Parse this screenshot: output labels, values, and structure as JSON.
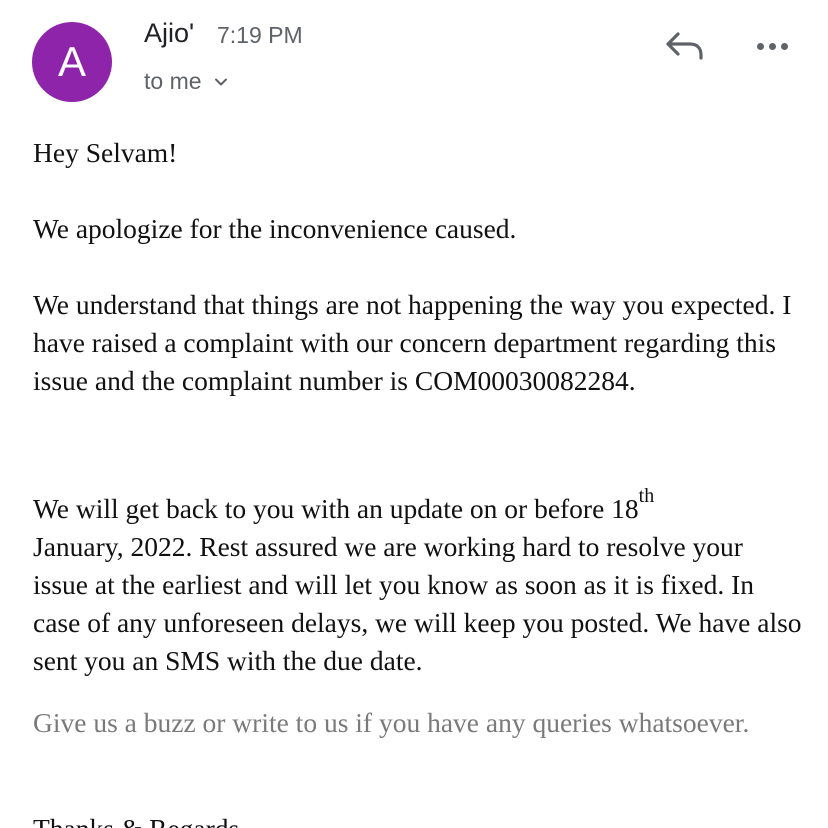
{
  "header": {
    "avatar_letter": "A",
    "avatar_color": "#8e24aa",
    "sender": "Ajio'",
    "time": "7:19 PM",
    "recipient": "to me",
    "icons": {
      "reply": "reply-icon",
      "more": "more-horizontal-icon",
      "expand": "chevron-down-icon"
    }
  },
  "email": {
    "greeting": "Hey Selvam!",
    "apology": "We apologize for the inconvenience caused.",
    "complaint": "We understand that things are not happening the way you expected. I have raised a complaint with our concern department regarding this issue and the complaint number is COM00030082284.",
    "update_before": "We will get back to you with an update on or before 18",
    "update_sup": "th",
    "update_after": "January, 2022. Rest assured we are working hard to resolve your issue at the earliest and will let you know as soon as it is fixed. In case of any unforeseen delays, we will keep you posted. We have also sent you an SMS with the due date.",
    "buzz": "Give us a buzz or write to us if you have any queries whatsoever.",
    "signoff": "Thanks & Regards"
  }
}
